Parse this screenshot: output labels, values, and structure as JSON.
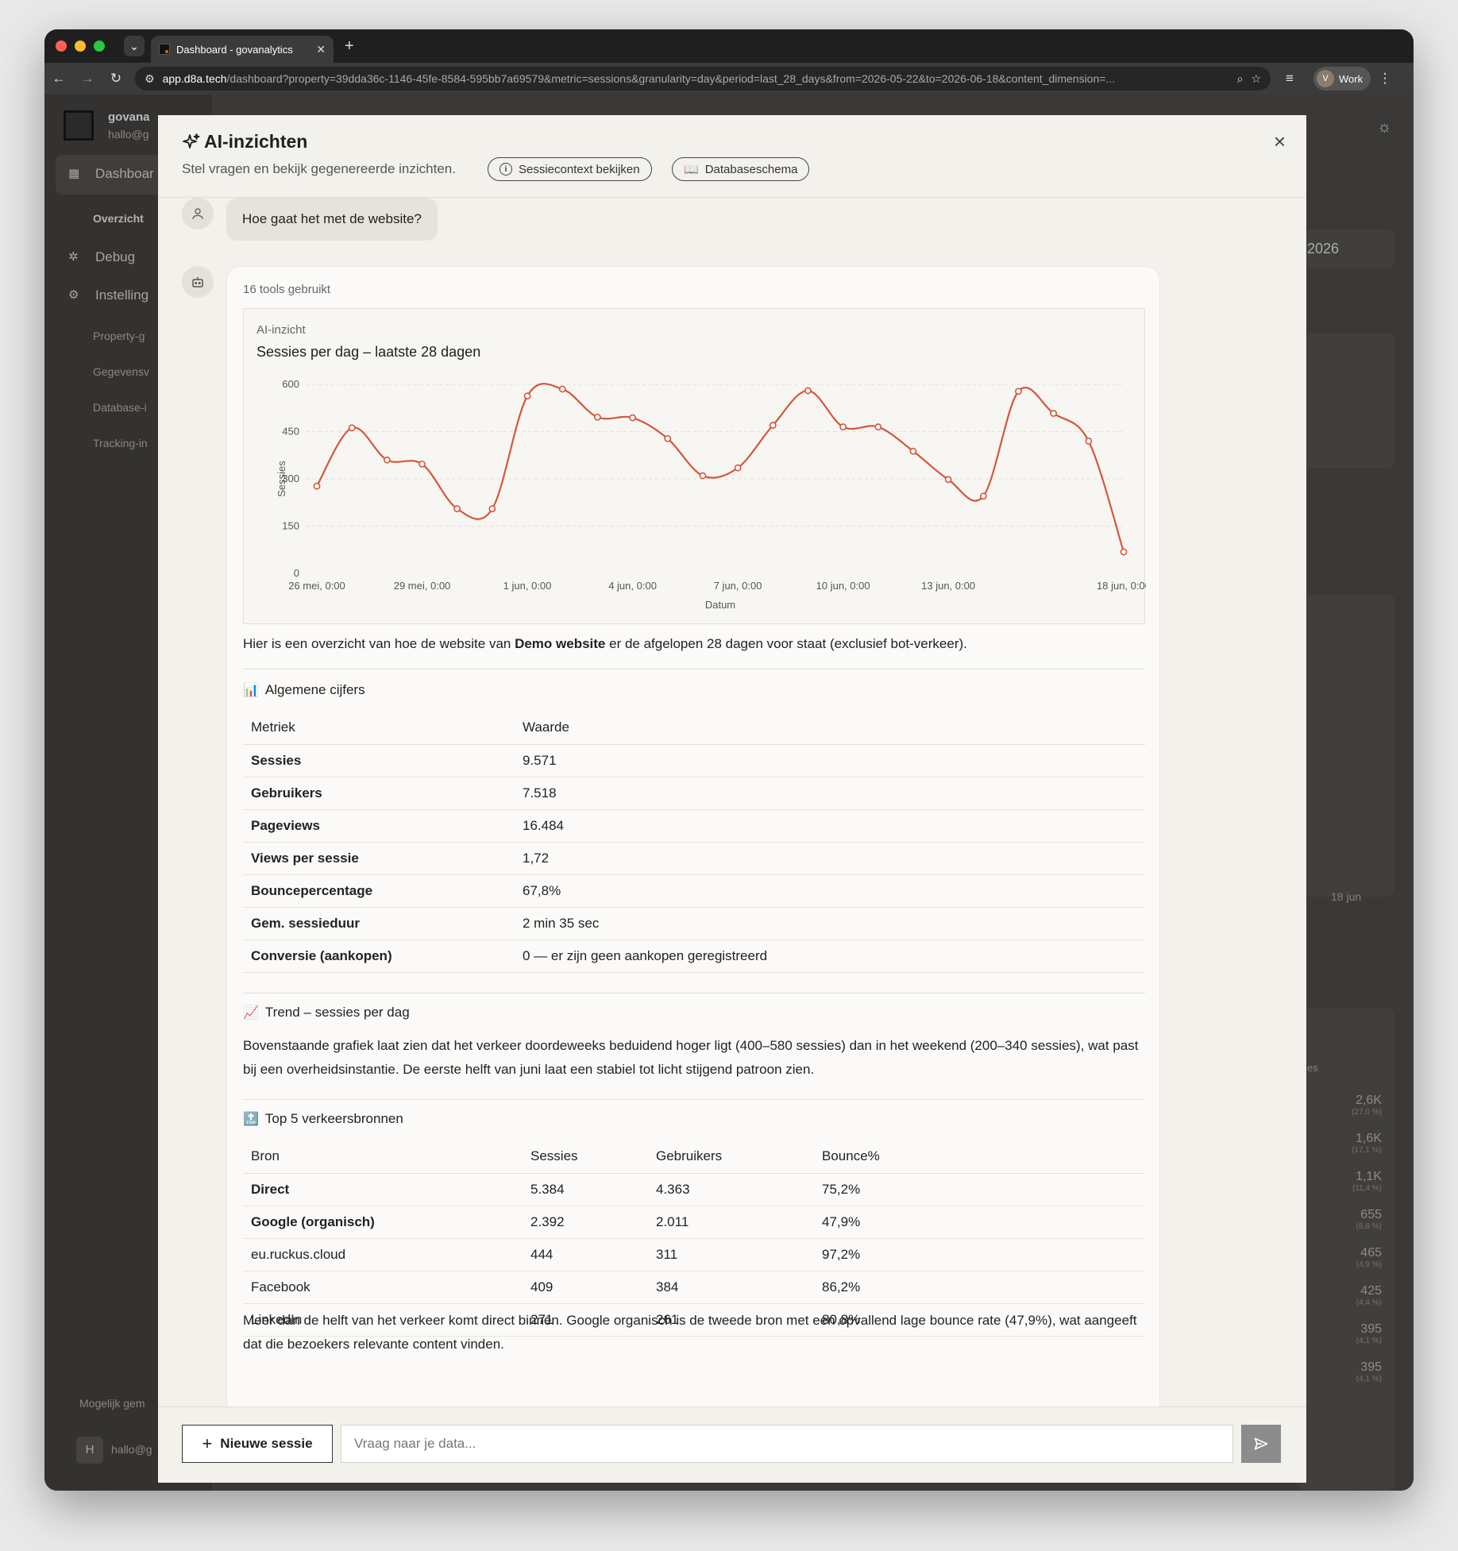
{
  "browser": {
    "tab_title": "Dashboard - govanalytics",
    "url_host": "app.d8a.tech",
    "url_path": "/dashboard?property=39dda36c-1146-45fe-8584-595bb7a69579&metric=sessions&granularity=day&period=last_28_days&from=2026-05-22&to=2026-06-18&content_dimension=...",
    "profile_initial": "V",
    "profile_name": "Work"
  },
  "background_app": {
    "brand": "govana",
    "email": "hallo@g",
    "nav_dashboard": "Dashboar",
    "nav_overview": "Overzicht",
    "nav_debug": "Debug",
    "nav_settings": "Instelling",
    "nav_property": "Property-g",
    "nav_data": "Gegevensv",
    "nav_database": "Database-i",
    "nav_tracking": "Tracking-in",
    "footer_label": "Mogelijk gem",
    "footer_user_initial": "H",
    "footer_user_email": "hallo@g",
    "year_label": "2026",
    "axis_label": "18 jun",
    "col_fragment": "es",
    "right_numbers": [
      {
        "value": "2,6K",
        "pct": "(27,0 %)"
      },
      {
        "value": "1,6K",
        "pct": "(17,1 %)"
      },
      {
        "value": "1,1K",
        "pct": "(11,4 %)"
      },
      {
        "value": "655",
        "pct": "(6,8 %)"
      },
      {
        "value": "465",
        "pct": "(4,9 %)"
      },
      {
        "value": "425",
        "pct": "(4,4 %)"
      },
      {
        "value": "395",
        "pct": "(4,1 %)"
      },
      {
        "value": "395",
        "pct": "(4,1 %)"
      }
    ]
  },
  "modal": {
    "title": "AI-inzichten",
    "subtitle": "Stel vragen en bekijk gegenereerde inzichten.",
    "session_context_button": "Sessiecontext bekijken",
    "schema_button": "Databaseschema",
    "user_message": "Hoe gaat het met de website?",
    "tools_used": "16 tools gebruikt",
    "insight_tag": "AI-inzicht",
    "intro_pre": "Hier is een overzicht van hoe de website van ",
    "intro_bold": "Demo website",
    "intro_post": " er de afgelopen 28 dagen voor staat (exclusief bot-verkeer).",
    "section_general_emoji": "📊",
    "section_general": "Algemene cijfers",
    "metrics_headers": [
      "Metriek",
      "Waarde"
    ],
    "metrics": [
      {
        "name": "Sessies",
        "value": "9.571"
      },
      {
        "name": "Gebruikers",
        "value": "7.518"
      },
      {
        "name": "Pageviews",
        "value": "16.484"
      },
      {
        "name": "Views per sessie",
        "value": "1,72"
      },
      {
        "name": "Bouncepercentage",
        "value": "67,8%"
      },
      {
        "name": "Gem. sessieduur",
        "value": "2 min 35 sec"
      },
      {
        "name": "Conversie (aankopen)",
        "value": "0 — er zijn geen aankopen geregistreerd"
      }
    ],
    "section_trend_emoji": "📈",
    "section_trend": "Trend – sessies per dag",
    "trend_text": "Bovenstaande grafiek laat zien dat het verkeer doordeweeks beduidend hoger ligt (400–580 sessies) dan in het weekend (200–340 sessies), wat past bij een overheidsinstantie. De eerste helft van juni laat een stabiel tot licht stijgend patroon zien.",
    "section_sources_emoji": "🔝",
    "section_sources": "Top 5 verkeersbronnen",
    "sources_headers": [
      "Bron",
      "Sessies",
      "Gebruikers",
      "Bounce%"
    ],
    "sources": [
      {
        "name": "Direct",
        "sessions": "5.384",
        "users": "4.363",
        "bounce": "75,2%",
        "bold": true
      },
      {
        "name": "Google (organisch)",
        "sessions": "2.392",
        "users": "2.011",
        "bounce": "47,9%",
        "bold": true
      },
      {
        "name": "eu.ruckus.cloud",
        "sessions": "444",
        "users": "311",
        "bounce": "97,2%",
        "bold": false
      },
      {
        "name": "Facebook",
        "sessions": "409",
        "users": "384",
        "bounce": "86,2%",
        "bold": false
      },
      {
        "name": "LinkedIn",
        "sessions": "271",
        "users": "261",
        "bounce": "80,8%",
        "bold": false
      }
    ],
    "sources_text": "Meer dan de helft van het verkeer komt direct binnen. Google organisch is de tweede bron met een opvallend lage bounce rate (47,9%), wat aangeeft dat die bezoekers relevante content vinden.",
    "new_session_button": "Nieuwe sessie",
    "input_placeholder": "Vraag naar je data..."
  },
  "chart_data": {
    "type": "line",
    "title": "Sessies per dag – laatste 28 dagen",
    "xlabel": "Datum",
    "ylabel": "Sessies",
    "ylim": [
      0,
      600
    ],
    "yticks": [
      0,
      150,
      300,
      450,
      600
    ],
    "xtick_labels": [
      "26 mei, 0:00",
      "29 mei, 0:00",
      "1 jun, 0:00",
      "4 jun, 0:00",
      "7 jun, 0:00",
      "10 jun, 0:00",
      "13 jun, 0:00",
      "18 jun, 0:00"
    ],
    "xtick_day_index": [
      0,
      3,
      6,
      9,
      12,
      15,
      18,
      23
    ],
    "grid": true,
    "color": "#d4573a",
    "series": [
      {
        "values": [
          277,
          462,
          360,
          347,
          205,
          205,
          563,
          585,
          496,
          494,
          428,
          310,
          335,
          470,
          580,
          465,
          465,
          388,
          298,
          245,
          578,
          508,
          420,
          68
        ]
      }
    ]
  }
}
